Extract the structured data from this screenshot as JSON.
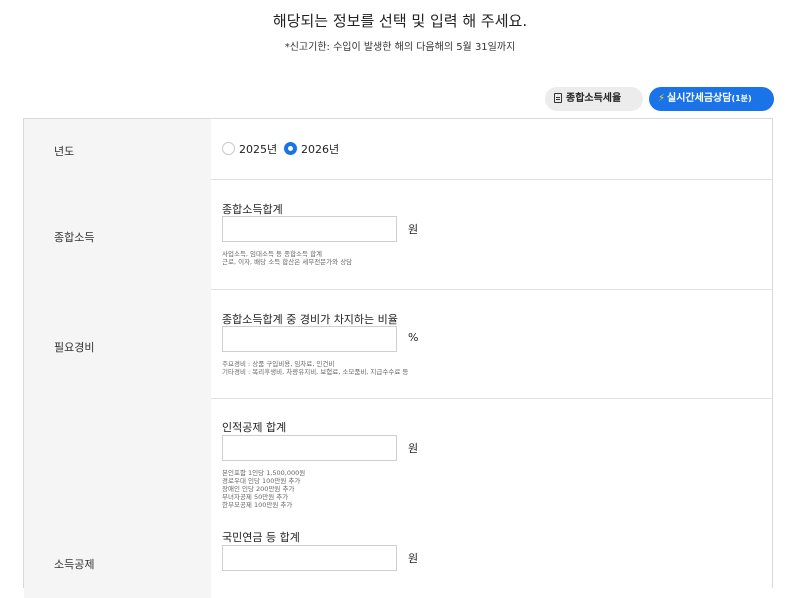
{
  "header": {
    "title": "해당되는 정보를 선택 및 입력 해 주세요.",
    "subtitle": "*신고기한: 수입이 발생한 해의 다음해의 5월 31일까지"
  },
  "actions": {
    "tax_rate_label": "종합소득세율",
    "consult_label": "실시간세금상담",
    "consult_badge": "(1분)",
    "consult_color": "#1a73e8"
  },
  "rows": {
    "year": {
      "label": "년도",
      "options": [
        {
          "label": "2025년",
          "selected": false
        },
        {
          "label": "2026년",
          "selected": true
        }
      ]
    },
    "income": {
      "label": "종합소득",
      "field_title": "종합소득합계",
      "value": "",
      "unit": "원",
      "notes": [
        "사업소득, 임대소득 등 종합소득 합계",
        "근로, 이자, 배당 소득 합산은 세무전문가와 상담"
      ]
    },
    "expense": {
      "label": "필요경비",
      "field_title": "종합소득합계 중 경비가 차지하는 비율",
      "value": "",
      "unit": "%",
      "notes": [
        "주요경비 : 상품 구입비용, 임차료, 인건비",
        "기타경비 : 복리후생비, 차량유지비, 보험료, 소모품비, 지급수수료 등"
      ]
    },
    "deduction": {
      "label": "소득공제",
      "personal": {
        "field_title": "인적공제 합계",
        "value": "",
        "unit": "원",
        "notes": [
          "본인포함 1인당 1,500,000원",
          "경로우대 인당 100만원 추가",
          "장애인 인당 200만원 추가",
          "부녀자공제 50만원 추가",
          "한부모공제 100만원 추가"
        ]
      },
      "pension": {
        "field_title": "국민연금 등 합계",
        "value": "",
        "unit": "원"
      }
    }
  }
}
